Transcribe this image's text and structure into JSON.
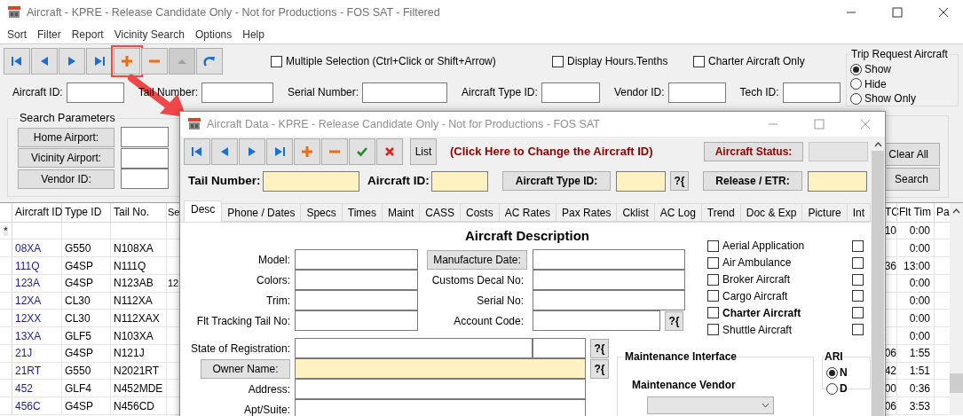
{
  "window": {
    "title": "Aircraft - KPRE - Release Candidate Only - Not for Productions - FOS SAT - Filtered"
  },
  "menu": [
    "Sort",
    "Filter",
    "Report",
    "Vicinity Search",
    "Options",
    "Help"
  ],
  "toolbar": {
    "buttons": [
      {
        "kind": "first",
        "disabled": false,
        "highlighted": false
      },
      {
        "kind": "prev",
        "disabled": false,
        "highlighted": false
      },
      {
        "kind": "next",
        "disabled": false,
        "highlighted": false
      },
      {
        "kind": "last",
        "disabled": false,
        "highlighted": false
      },
      {
        "kind": "add",
        "disabled": false,
        "highlighted": true
      },
      {
        "kind": "delete",
        "disabled": false,
        "highlighted": false
      },
      {
        "kind": "up",
        "disabled": true,
        "highlighted": false
      },
      {
        "kind": "refresh",
        "disabled": false,
        "highlighted": false
      }
    ],
    "checkboxes": [
      {
        "label": "Multiple Selection (Ctrl+Click or Shift+Arrow)",
        "checked": false
      },
      {
        "label": "Display Hours.Tenths",
        "checked": false
      },
      {
        "label": "Charter Aircraft Only",
        "checked": false
      }
    ]
  },
  "trip_request": {
    "title": "Trip Request Aircraft",
    "options": [
      {
        "label": "Show",
        "selected": true
      },
      {
        "label": "Hide",
        "selected": false
      },
      {
        "label": "Show Only",
        "selected": false
      }
    ]
  },
  "search_fields": [
    {
      "label": "Aircraft ID:"
    },
    {
      "label": "Tail Number:"
    },
    {
      "label": "Serial Number:"
    },
    {
      "label": "Aircraft Type ID:"
    },
    {
      "label": "Vendor ID:"
    },
    {
      "label": "Tech ID:"
    }
  ],
  "search_parameters": {
    "title": "Search Parameters",
    "buttons": [
      "Home Airport:",
      "Vicinity Airport:",
      "Vendor ID:"
    ]
  },
  "actions": [
    "Clear All",
    "Search"
  ],
  "grid": {
    "columns": [
      "Aircraft ID",
      "Type ID",
      "Tail No.",
      "Se"
    ],
    "right_columns": [
      "TC",
      "Flt Tim",
      "Pa"
    ],
    "rows": [
      {
        "marker": "*",
        "tc": "10",
        "flt_time": "0:00"
      },
      {
        "aircraft_id": "08XA",
        "type_id": "G550",
        "tail_no": "N108XA",
        "flt_time": "0:00"
      },
      {
        "aircraft_id": "111Q",
        "type_id": "G4SP",
        "tail_no": "N111Q",
        "tc": "36",
        "flt_time": "13:00"
      },
      {
        "aircraft_id": "123A",
        "type_id": "G4SP",
        "tail_no": "N123AB",
        "column_4": "12",
        "flt_time": "0:00"
      },
      {
        "aircraft_id": "12XA",
        "type_id": "CL30",
        "tail_no": "N112XA",
        "flt_time": "0:00"
      },
      {
        "aircraft_id": "12XX",
        "type_id": "CL30",
        "tail_no": "N112XAX",
        "flt_time": "0:00"
      },
      {
        "aircraft_id": "13XA",
        "type_id": "GLF5",
        "tail_no": "N103XA",
        "flt_time": "0:00"
      },
      {
        "aircraft_id": "21J",
        "type_id": "G4SP",
        "tail_no": "N121J",
        "tc": "06",
        "flt_time": "1:55"
      },
      {
        "aircraft_id": "21RT",
        "type_id": "G550",
        "tail_no": "N2021RT",
        "tc": "42",
        "flt_time": "1:51"
      },
      {
        "aircraft_id": "452",
        "type_id": "GLF4",
        "tail_no": "N452MDE",
        "tc": "00",
        "flt_time": "0:36"
      },
      {
        "aircraft_id": "456C",
        "type_id": "G4SP",
        "tail_no": "N456CD",
        "tc": "06",
        "flt_time": "3:53"
      }
    ]
  },
  "dialog": {
    "title": "Aircraft Data - KPRE - Release Candidate Only - Not for Productions - FOS SAT",
    "toolbar": [
      {
        "kind": "first"
      },
      {
        "kind": "prev"
      },
      {
        "kind": "next"
      },
      {
        "kind": "last"
      },
      {
        "kind": "add"
      },
      {
        "kind": "delete"
      },
      {
        "kind": "save"
      },
      {
        "kind": "cancel"
      }
    ],
    "list_button": "List",
    "change_id_link": "(Click Here to Change the Aircraft ID)",
    "status_button": "Aircraft Status:",
    "release_button": "Release / ETR:",
    "tail_label": "Tail Number:",
    "aircraft_id_label": "Aircraft ID:",
    "type_button": "Aircraft Type ID:",
    "type_lookup": "?{",
    "tabs": [
      {
        "label": "Desc",
        "selected": true
      },
      {
        "label": "Phone / Dates",
        "selected": false
      },
      {
        "label": "Specs",
        "selected": false
      },
      {
        "label": "Times",
        "selected": false
      },
      {
        "label": "Maint",
        "selected": false
      },
      {
        "label": "CASS",
        "selected": false
      },
      {
        "label": "Costs",
        "selected": false
      },
      {
        "label": "AC Rates",
        "selected": false
      },
      {
        "label": "Pax Rates",
        "selected": false
      },
      {
        "label": "Cklist",
        "selected": false
      },
      {
        "label": "AC Log",
        "selected": false
      },
      {
        "label": "Trend",
        "selected": false
      },
      {
        "label": "Doc & Exp",
        "selected": false
      },
      {
        "label": "Picture",
        "selected": false
      },
      {
        "label": "Int",
        "selected": false
      }
    ],
    "section_title": "Aircraft Description",
    "left_fields": [
      {
        "label": "Model:"
      },
      {
        "label": "Colors:"
      },
      {
        "label": "Trim:"
      },
      {
        "label": "Flt Tracking Tail No:"
      }
    ],
    "middle_fields": [
      {
        "label": "Manufacture Date:",
        "kind": "button"
      },
      {
        "label": "Customs Decal No:",
        "kind": "label"
      },
      {
        "label": "Serial No:",
        "kind": "label"
      },
      {
        "label": "Account Code:",
        "kind": "lookup",
        "lookup": "?{"
      }
    ],
    "checkboxes": [
      {
        "label": "Aerial Application",
        "checked": false,
        "bold": false
      },
      {
        "label": "Air Ambulance",
        "checked": false,
        "bold": false
      },
      {
        "label": "Broker Aircraft",
        "checked": false,
        "bold": false
      },
      {
        "label": "Cargo Aircraft",
        "checked": false,
        "bold": false
      },
      {
        "label": "Charter Aircraft",
        "checked": false,
        "bold": true
      },
      {
        "label": "Shuttle Aircraft",
        "checked": false,
        "bold": false
      }
    ],
    "extra_checkboxes": [
      {
        "checked": false
      },
      {
        "checked": false
      },
      {
        "checked": false
      },
      {
        "checked": false
      },
      {
        "checked": false
      },
      {
        "checked": false
      }
    ],
    "lower_fields": [
      {
        "label": "State of Registration:",
        "kind": "split",
        "required": false,
        "lookup": "?{"
      },
      {
        "label": "Owner Name:",
        "kind": "button",
        "required": true,
        "lookup": "?{"
      },
      {
        "label": "Address:",
        "kind": "label",
        "required": false
      },
      {
        "label": "Apt/Suite:",
        "kind": "label",
        "required": false
      }
    ],
    "maintenance": {
      "title": "Maintenance Interface",
      "vendor_label": "Maintenance Vendor"
    },
    "ari": {
      "title": "ARI",
      "options": [
        {
          "label": "N",
          "selected": true
        },
        {
          "label": "D",
          "selected": false
        }
      ]
    }
  }
}
